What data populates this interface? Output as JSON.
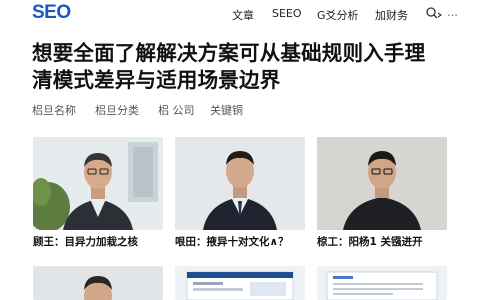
{
  "header": {
    "logo": "SEO",
    "nav": [
      {
        "label": "文章"
      },
      {
        "label": "SEEO"
      },
      {
        "label": "G爻分析"
      },
      {
        "label": "加财务"
      }
    ],
    "more": "…"
  },
  "article": {
    "title_line1": "想要全面了解解决方案可从基础规则入手理",
    "title_line2": "清模式差异与适用场景边界",
    "meta": [
      "梠旦名称",
      "梠旦分类",
      "梠 公司",
      "关键铜"
    ]
  },
  "cards": [
    {
      "caption": "顾王：目异力加栽之核"
    },
    {
      "caption": "哏田：掖异十对文化∧？"
    },
    {
      "caption": "椋工：阳杨1 关镪进开"
    }
  ],
  "colors": {
    "brand": "#1a56c9",
    "text": "#111111",
    "muted": "#555555"
  },
  "icons": {
    "user": "user-circle-icon"
  }
}
